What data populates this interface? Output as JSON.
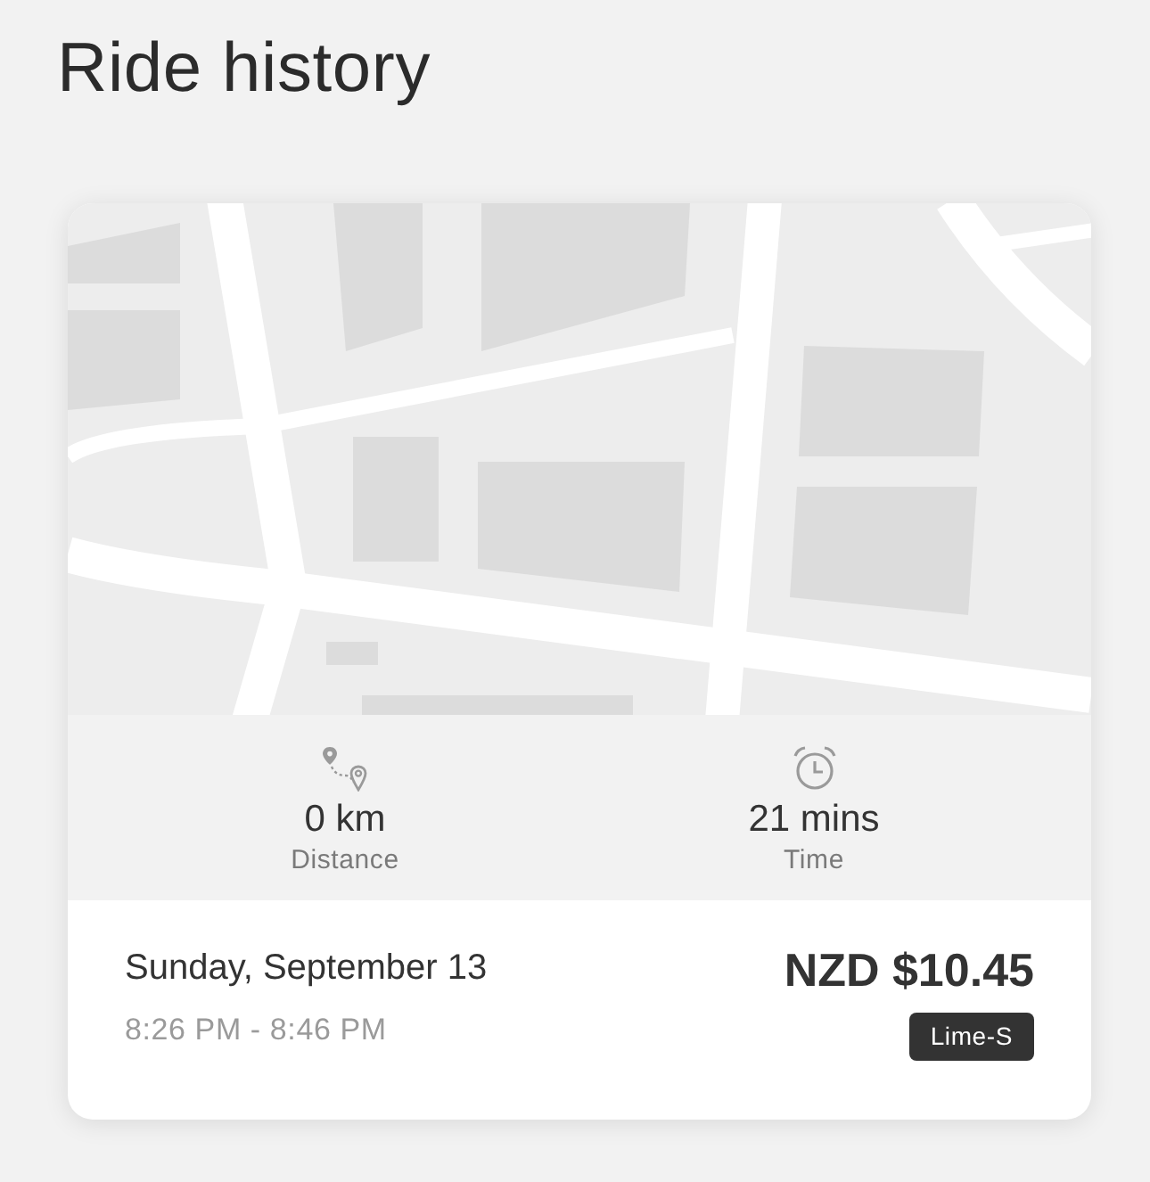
{
  "title": "Ride history",
  "ride": {
    "stats": [
      {
        "kind": "distance",
        "value": "0 km",
        "label": "Distance"
      },
      {
        "kind": "time",
        "value": "21 mins",
        "label": "Time"
      }
    ],
    "date": "Sunday, September 13",
    "time_range": "8:26 PM - 8:46 PM",
    "price": "NZD $10.45",
    "vehicle": "Lime-S"
  }
}
